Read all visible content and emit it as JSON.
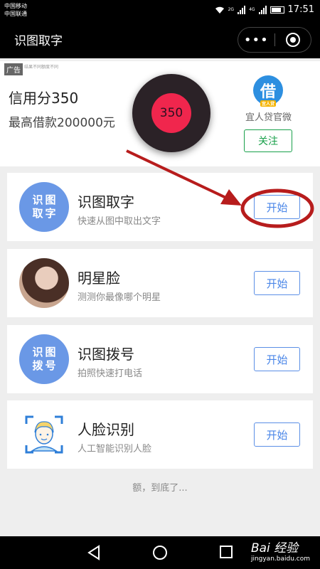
{
  "status_bar": {
    "carrier_1": "中国移动",
    "carrier_2": "中国联通",
    "network_1": "2G",
    "network_2": "4G",
    "time": "17:51",
    "icons": [
      "wifi-icon",
      "signal-icon",
      "battery-icon"
    ]
  },
  "title_bar": {
    "title": "识图取字",
    "more_label": "•••",
    "icons": [
      "more-icon",
      "close-mini-program-icon"
    ]
  },
  "ad": {
    "tag": "广告",
    "note": "结果不同额度不同",
    "line1": "信用分350",
    "line2": "最高借款200000元",
    "score_badge": "350",
    "brand_logo_char": "借",
    "brand_logo_sub": "宜人贷",
    "brand_name": "宜人贷官微",
    "follow_label": "关注",
    "colors": {
      "follow": "#18a04a",
      "badge": "#f0264d",
      "logo": "#2d8fe0"
    }
  },
  "items": [
    {
      "avatar_text": "识图\n取字",
      "title": "识图取字",
      "subtitle": "快速从图中取出文字",
      "button": "开始",
      "avatar_icon": "ocr-icon"
    },
    {
      "avatar_text": "",
      "title": "明星脸",
      "subtitle": "测测你最像哪个明星",
      "button": "开始",
      "avatar_icon": "celebrity-photo"
    },
    {
      "avatar_text": "识图\n拨号",
      "title": "识图拨号",
      "subtitle": "拍照快速打电话",
      "button": "开始",
      "avatar_icon": "dial-icon"
    },
    {
      "avatar_text": "",
      "title": "人脸识别",
      "subtitle": "人工智能识别人脸",
      "button": "开始",
      "avatar_icon": "face-scan-icon"
    }
  ],
  "footer": "额，到底了...",
  "nav": {
    "icons": [
      "back-icon",
      "home-icon",
      "recents-icon"
    ]
  },
  "watermark": {
    "brand": "Bai 经验",
    "url": "jingyan.baidu.com"
  },
  "colors": {
    "accent": "#4a86e8",
    "annotation": "#b71c1c"
  }
}
